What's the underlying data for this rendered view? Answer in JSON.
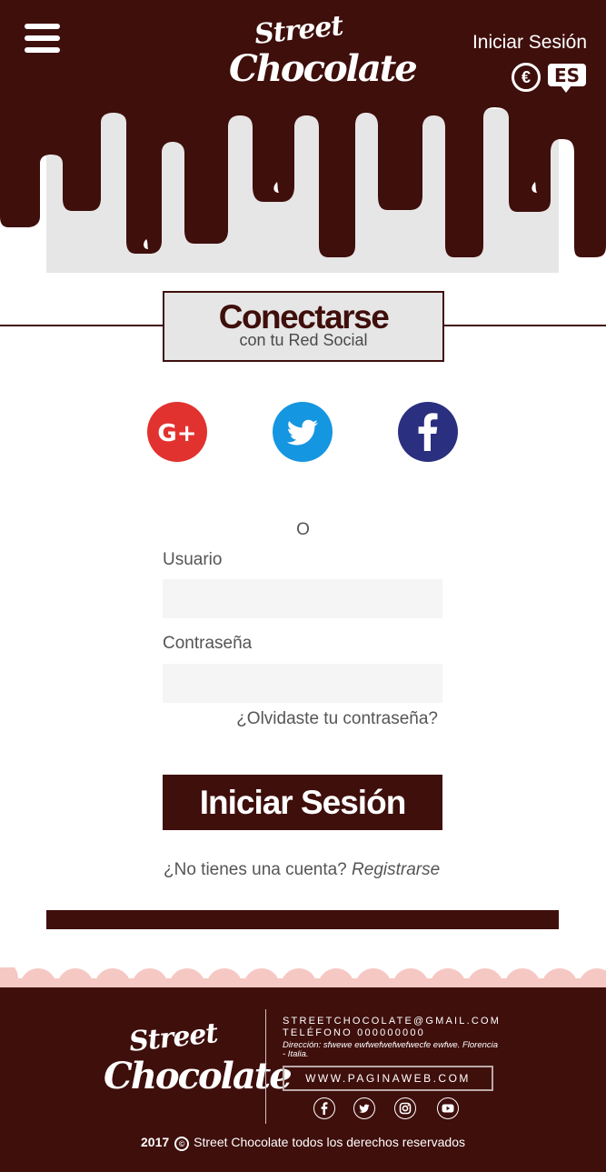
{
  "colors": {
    "brand": "#3f0f0c",
    "panel": "#e6e6e6",
    "google": "#e2322f",
    "twitter": "#1596e0",
    "facebook": "#2b2f7f",
    "scallop": "#f6c8c4"
  },
  "header": {
    "menu_icon": "hamburger-icon",
    "logo_line1": "Street",
    "logo_line2": "Chocolate",
    "login_link": "Iniciar Sesión",
    "currency_symbol": "€",
    "language": "ES"
  },
  "login": {
    "title": "Conectarse",
    "subtitle": "con tu Red Social",
    "google_label": "G+",
    "or_text": "O",
    "username_label": "Usuario",
    "username_value": "",
    "password_label": "Contraseña",
    "password_value": "",
    "forgot_link": "¿Olvidaste tu contraseña?",
    "submit_label": "Iniciar Sesión",
    "signup_text": "¿No tienes una cuenta?",
    "signup_link": "Registrarse"
  },
  "footer": {
    "logo_line1": "Street",
    "logo_line2": "Chocolate",
    "email": "STREETCHOCOLATE@GMAIL.COM",
    "phone": "TELÉFONO 000000000",
    "address": "Dirección: sfwewe ewfwefwefwefwecfe ewfwe. Florencia - Italia.",
    "website": "WWW.PAGINAWEB.COM",
    "social_icons": [
      "facebook-icon",
      "twitter-icon",
      "instagram-icon",
      "youtube-icon"
    ],
    "copyright_year": "2017",
    "copyright_symbol": "©",
    "copyright_text": "Street Chocolate todos los derechos reservados"
  }
}
